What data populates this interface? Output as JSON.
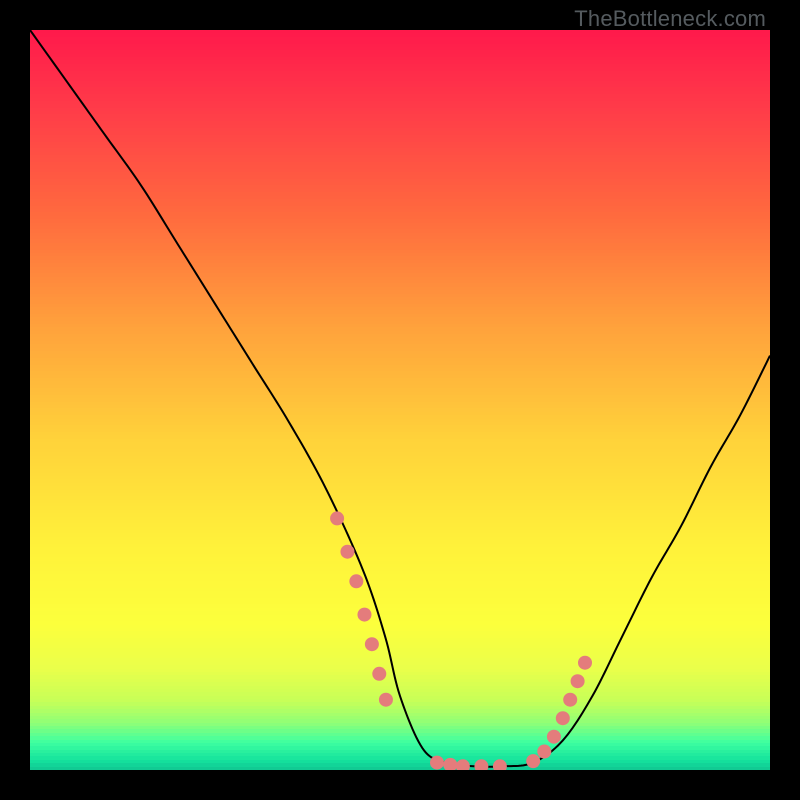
{
  "watermark": "TheBottleneck.com",
  "chart_data": {
    "type": "line",
    "title": "",
    "xlabel": "",
    "ylabel": "",
    "xlim": [
      0,
      100
    ],
    "ylim": [
      0,
      100
    ],
    "gradient_stops": [
      {
        "pos": 0.0,
        "color": "#ff1a4b"
      },
      {
        "pos": 0.1,
        "color": "#ff3a49"
      },
      {
        "pos": 0.25,
        "color": "#ff6b3e"
      },
      {
        "pos": 0.4,
        "color": "#ffa23c"
      },
      {
        "pos": 0.55,
        "color": "#ffd23a"
      },
      {
        "pos": 0.7,
        "color": "#fff23a"
      },
      {
        "pos": 0.8,
        "color": "#fcff3c"
      },
      {
        "pos": 0.86,
        "color": "#eaff4a"
      },
      {
        "pos": 0.905,
        "color": "#c6ff58"
      },
      {
        "pos": 0.935,
        "color": "#8dff78"
      },
      {
        "pos": 0.96,
        "color": "#3fffa0"
      },
      {
        "pos": 0.985,
        "color": "#14e29d"
      },
      {
        "pos": 1.0,
        "color": "#0fbf8f"
      }
    ],
    "series": [
      {
        "name": "bottleneck-curve",
        "x": [
          0,
          5,
          10,
          15,
          20,
          25,
          30,
          35,
          40,
          45,
          48,
          50,
          53,
          56,
          60,
          64,
          68,
          72,
          76,
          80,
          84,
          88,
          92,
          96,
          100
        ],
        "y": [
          100,
          93,
          86,
          79,
          71,
          63,
          55,
          47,
          38,
          27,
          18,
          10,
          3,
          1,
          0.5,
          0.5,
          1,
          4,
          10,
          18,
          26,
          33,
          41,
          48,
          56
        ]
      }
    ],
    "highlight_points": {
      "name": "highlight-dots",
      "x": [
        41.5,
        42.9,
        44.1,
        45.2,
        46.2,
        47.2,
        48.1,
        55.0,
        56.8,
        58.5,
        61.0,
        63.5,
        68.0,
        69.5,
        70.8,
        72.0,
        73.0,
        74.0,
        75.0
      ],
      "y": [
        34.0,
        29.5,
        25.5,
        21.0,
        17.0,
        13.0,
        9.5,
        1.0,
        0.7,
        0.5,
        0.5,
        0.5,
        1.2,
        2.5,
        4.5,
        7.0,
        9.5,
        12.0,
        14.5
      ]
    }
  }
}
